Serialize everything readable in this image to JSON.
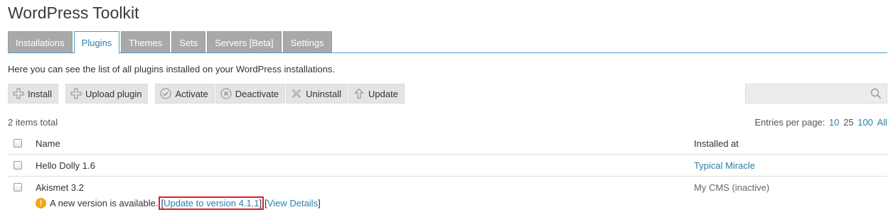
{
  "page": {
    "title": "WordPress Toolkit"
  },
  "tabs": [
    {
      "label": "Installations",
      "active": false
    },
    {
      "label": "Plugins",
      "active": true
    },
    {
      "label": "Themes",
      "active": false
    },
    {
      "label": "Sets",
      "active": false
    },
    {
      "label": "Servers [Beta]",
      "active": false
    },
    {
      "label": "Settings",
      "active": false
    }
  ],
  "description": "Here you can see the list of all plugins installed on your WordPress installations.",
  "toolbar": {
    "install": "Install",
    "upload": "Upload plugin",
    "activate": "Activate",
    "deactivate": "Deactivate",
    "uninstall": "Uninstall",
    "update": "Update"
  },
  "search": {
    "placeholder": "",
    "value": ""
  },
  "list": {
    "total": "2 items total",
    "entries_label": "Entries per page:",
    "entries_options": [
      "10",
      "25",
      "100",
      "All"
    ]
  },
  "table": {
    "headers": {
      "name": "Name",
      "installed_at": "Installed at"
    },
    "rows": [
      {
        "name": "Hello Dolly 1.6",
        "installed_at": "Typical Miracle"
      },
      {
        "name": "Akismet 3.2",
        "installed_at": "My CMS (inactive)",
        "notice": {
          "text": "A new version is available.",
          "open_bracket": "[",
          "update_link": "Update to version 4.1.1",
          "mid_bracket": "]",
          "details_open": "[",
          "details_link": "View Details",
          "close_bracket": "]"
        }
      }
    ]
  },
  "colors": {
    "accent": "#2a7fa8",
    "tab_inactive": "#a9a9a9",
    "warning": "#f3a619",
    "highlight": "#d9222a"
  },
  "icons": {
    "install": "plus-icon",
    "upload": "plus-icon",
    "activate": "check-circle-icon",
    "deactivate": "x-circle-icon",
    "uninstall": "x-icon",
    "update": "arrow-up-icon",
    "search": "search-icon",
    "warning": "warning-icon"
  }
}
